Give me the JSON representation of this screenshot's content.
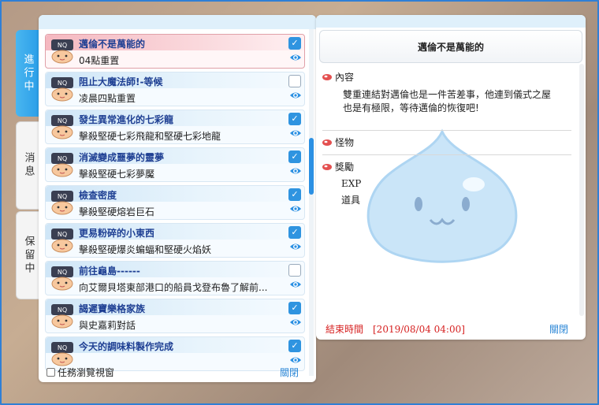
{
  "side_tabs": {
    "active": "進行中",
    "messages": "消息",
    "hold": "保留中"
  },
  "quests": [
    {
      "title": "邁倫不是萬能的",
      "desc": "04點重置",
      "checked": true,
      "selected": true
    },
    {
      "title": "阻止大魔法師!-等候",
      "desc": "凌晨四點重置",
      "checked": false,
      "selected": false
    },
    {
      "title": "發生異常進化的七彩龍",
      "desc": "擊殺堅硬七彩飛龍和堅硬七彩地龍",
      "checked": true,
      "selected": false
    },
    {
      "title": "消滅變成噩夢的靈夢",
      "desc": "擊殺堅硬七彩夢魘",
      "checked": true,
      "selected": false
    },
    {
      "title": "檢查密度",
      "desc": "擊殺堅硬熔岩巨石",
      "checked": true,
      "selected": false
    },
    {
      "title": "更易粉碎的小東西",
      "desc": "擊殺堅硬爆炎蝙蝠和堅硬火焰妖",
      "checked": true,
      "selected": false
    },
    {
      "title": "前往龜島------",
      "desc": "向艾爾貝塔東部港口的船員戈登布魯了解前...",
      "checked": false,
      "selected": false
    },
    {
      "title": "謁遲寶樂格家族",
      "desc": "與史嘉莉對話",
      "checked": true,
      "selected": false
    },
    {
      "title": "今天的調味料製作完成",
      "desc": "",
      "checked": true,
      "selected": false
    }
  ],
  "left_footer": {
    "browse_label": "任務瀏覽視窗",
    "close_label": "關閉"
  },
  "detail": {
    "title": "邁倫不是萬能的",
    "content_label": "內容",
    "content_line1": "雙重連結對邁倫也是一件苦差事，他連到儀式之屋",
    "content_line2": "也是有極限，等待邁倫的恢復吧!",
    "monster_label": "怪物",
    "reward_label": "獎勵",
    "reward_exp": "EXP",
    "reward_item": "道具",
    "end_time": "結束時間　[2019/08/04 04:00]",
    "close_label": "關閉"
  },
  "colors": {
    "accent": "#2b90e3",
    "title_text": "#1e3f93",
    "end_time": "#d62020",
    "link": "#2a86d6"
  },
  "icons": {
    "npc": "npc-portrait-icon",
    "eye": "eye-icon",
    "section": "section-bullet-icon"
  }
}
